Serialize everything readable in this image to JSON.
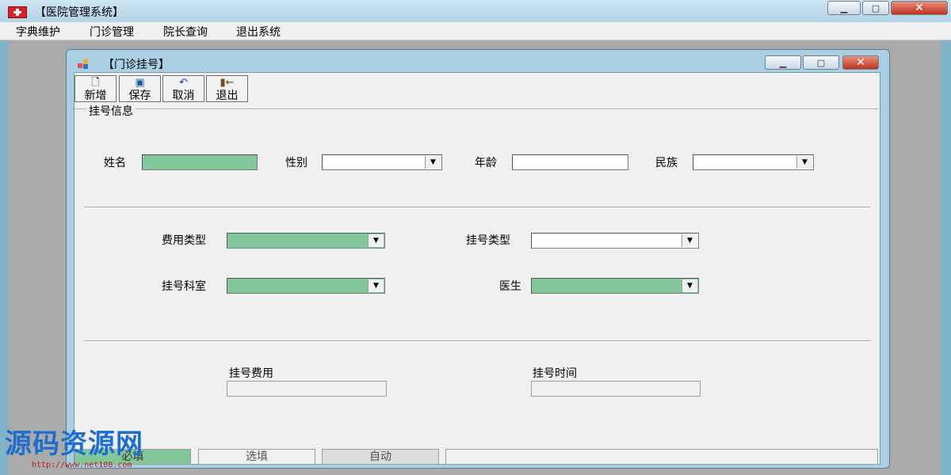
{
  "app": {
    "title": "【医院管理系统】"
  },
  "menu": [
    "字典维护",
    "门诊管理",
    "院长查询",
    "退出系统"
  ],
  "child_window": {
    "title": "【门诊挂号】",
    "toolbar": [
      {
        "label": "新增",
        "icon": "new-document-icon"
      },
      {
        "label": "保存",
        "icon": "save-disk-icon"
      },
      {
        "label": "取消",
        "icon": "undo-arrow-icon"
      },
      {
        "label": "退出",
        "icon": "exit-door-icon"
      }
    ],
    "group_title": "挂号信息",
    "fields": {
      "name_label": "姓名",
      "name_value": "",
      "gender_label": "性别",
      "gender_value": "",
      "age_label": "年龄",
      "age_value": "",
      "ethnicity_label": "民族",
      "ethnicity_value": "",
      "fee_type_label": "费用类型",
      "fee_type_value": "",
      "reg_type_label": "挂号类型",
      "reg_type_value": "",
      "department_label": "挂号科室",
      "department_value": "",
      "doctor_label": "医生",
      "doctor_value": "",
      "reg_fee_label": "挂号费用",
      "reg_fee_value": "",
      "reg_time_label": "挂号时间",
      "reg_time_value": ""
    },
    "status_legend": {
      "required": "必填",
      "optional": "选填",
      "auto": "自动"
    }
  },
  "watermark": {
    "text": "源码资源网",
    "url": "http://www.net188.com"
  },
  "colors": {
    "required_field": "#84c79a",
    "titlebar": "#b2d2e6"
  }
}
